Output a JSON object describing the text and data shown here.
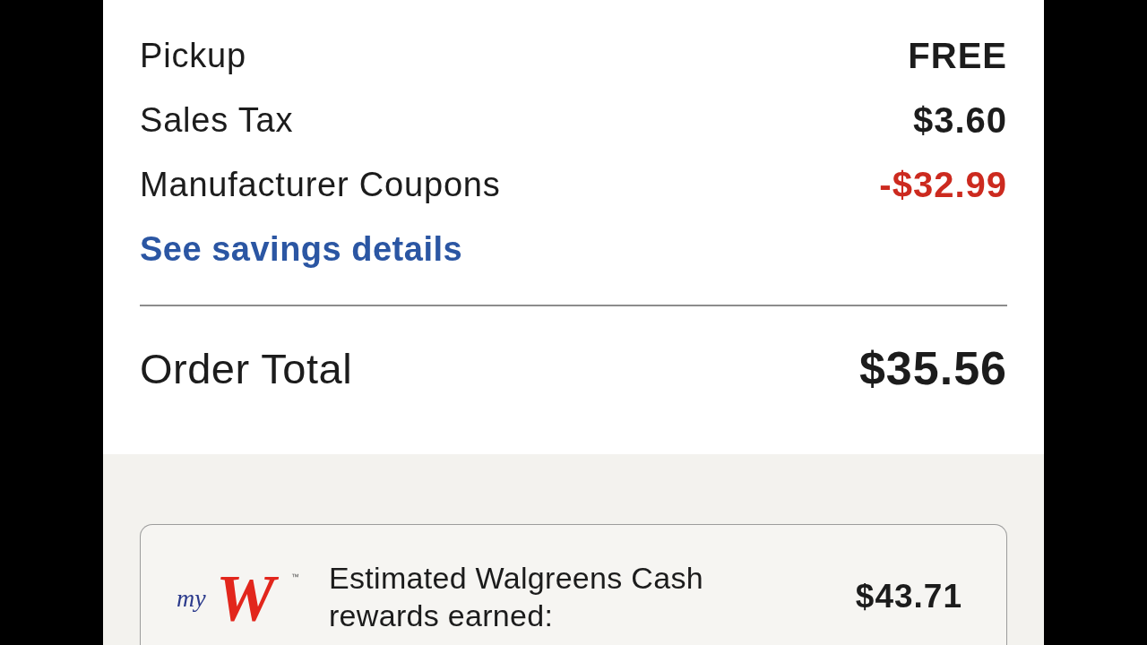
{
  "summary_rows": [
    {
      "kind": "charge",
      "label": "Pickup",
      "amount": "FREE"
    },
    {
      "kind": "charge",
      "label": "Sales Tax",
      "amount": "$3.60"
    },
    {
      "kind": "discount",
      "label": "Manufacturer Coupons",
      "amount": "-$32.99"
    }
  ],
  "savings_link": "See savings details",
  "order_total": {
    "label": "Order Total",
    "amount": "$35.56"
  },
  "rewards": {
    "logo": {
      "prefix": "my",
      "mark": "W",
      "trademark": "™"
    },
    "label": "Estimated Walgreens Cash rewards earned:",
    "amount": "$43.71"
  }
}
